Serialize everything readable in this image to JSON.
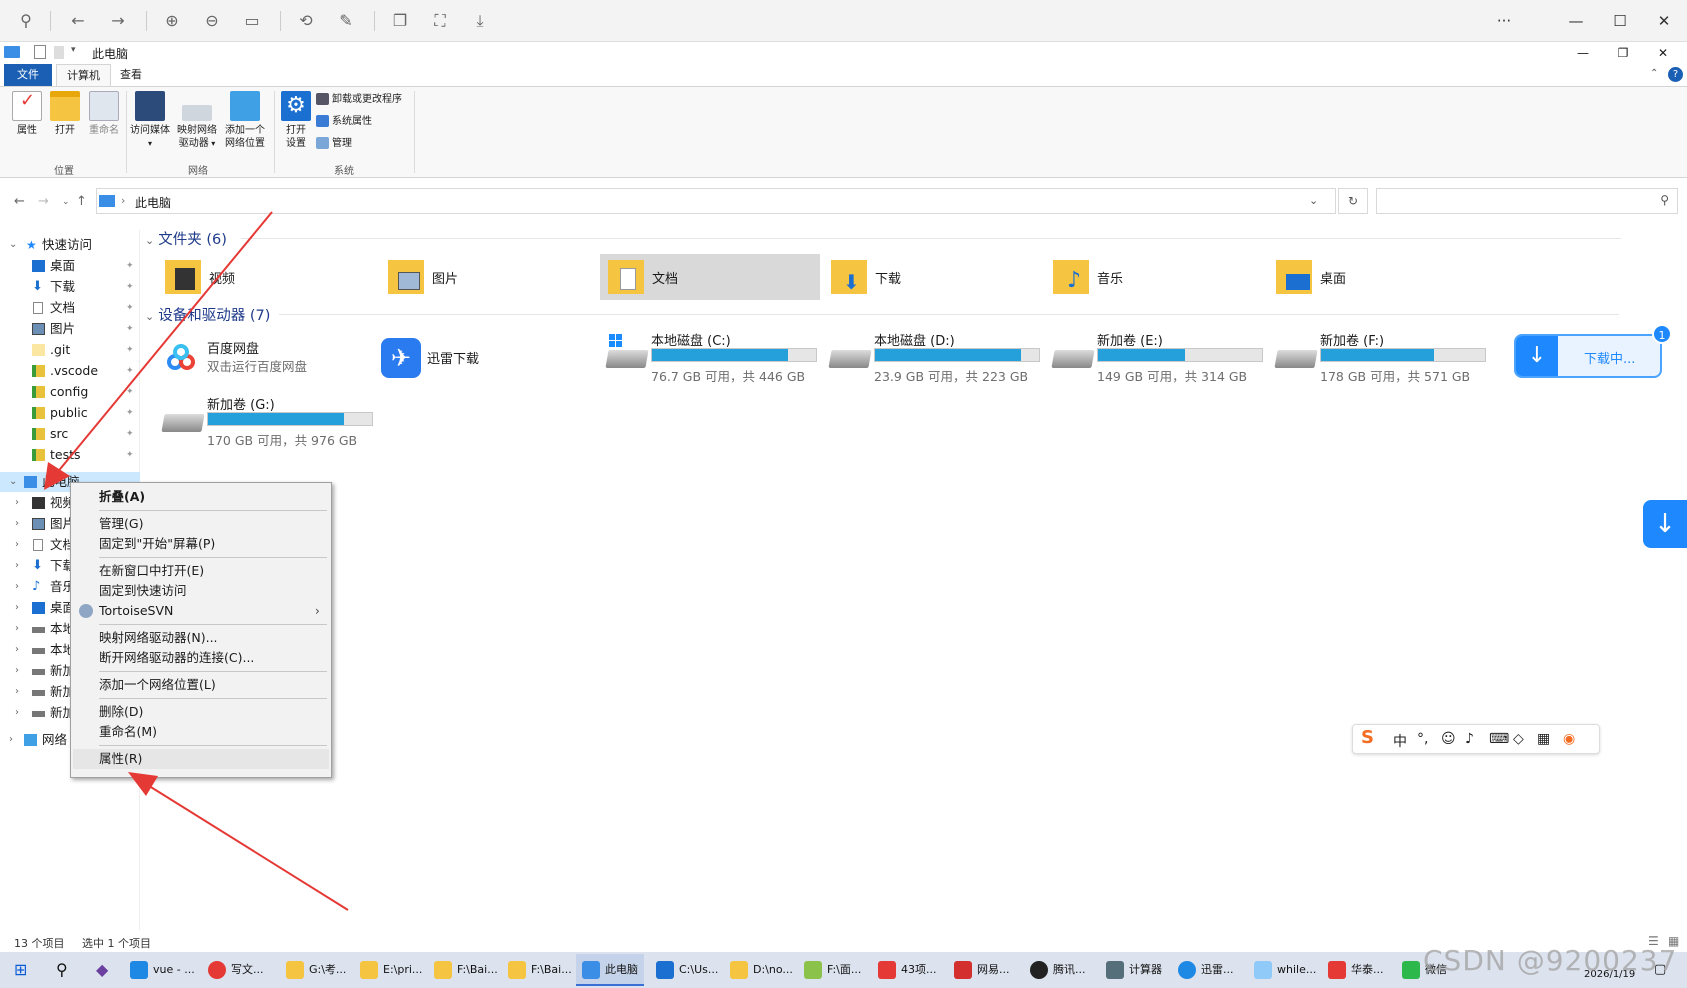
{
  "viewer": {
    "more": "···",
    "minimize": "—",
    "maximize": "☐",
    "close": "✕"
  },
  "window": {
    "title": "此电脑"
  },
  "ribbon": {
    "tabs": [
      "文件",
      "计算机",
      "查看"
    ],
    "location": {
      "group": "位置",
      "properties": "属性",
      "open": "打开",
      "rename": "重命名"
    },
    "network": {
      "group": "网络",
      "access_media": "访问媒体",
      "map_drive_1": "映射网络",
      "map_drive_2": "驱动器",
      "add_location_1": "添加一个",
      "add_location_2": "网络位置"
    },
    "system": {
      "group": "系统",
      "open_settings_1": "打开",
      "open_settings_2": "设置",
      "uninstall": "卸载或更改程序",
      "sys_props": "系统属性",
      "manage": "管理"
    }
  },
  "address": {
    "path": "此电脑",
    "search_placeholder": ""
  },
  "tree": {
    "quick_access": "快速访问",
    "quick_items": [
      "桌面",
      "下载",
      "文档",
      "图片",
      ".git",
      ".vscode",
      "config",
      "public",
      "src",
      "tests"
    ],
    "this_pc": "此电脑",
    "pc_items": [
      "视频",
      "图片",
      "文档",
      "下载",
      "音乐",
      "桌面",
      "本地磁盘 (C:)",
      "本地磁盘 (D:)",
      "新加卷 (E:)",
      "新加卷 (F:)",
      "新加卷 (G:)"
    ],
    "network": "网络"
  },
  "folders": {
    "heading": "文件夹 (6)",
    "items": [
      "视频",
      "图片",
      "文档",
      "下载",
      "音乐",
      "桌面"
    ]
  },
  "drives": {
    "heading": "设备和驱动器 (7)",
    "baidu": {
      "name": "百度网盘",
      "sub": "双击运行百度网盘"
    },
    "xunlei": {
      "name": "迅雷下载"
    },
    "items": [
      {
        "name": "本地磁盘 (C:)",
        "space": "76.7 GB 可用，共 446 GB",
        "used": 0.83
      },
      {
        "name": "本地磁盘 (D:)",
        "space": "23.9 GB 可用，共 223 GB",
        "used": 0.89
      },
      {
        "name": "新加卷 (E:)",
        "space": "149 GB 可用，共 314 GB",
        "used": 0.53
      },
      {
        "name": "新加卷 (F:)",
        "space": "178 GB 可用，共 571 GB",
        "used": 0.69
      },
      {
        "name": "新加卷 (G:)",
        "space": "170 GB 可用，共 976 GB",
        "used": 0.83
      }
    ]
  },
  "context_menu": {
    "collapse": "折叠(A)",
    "manage": "管理(G)",
    "pin_start": "固定到\"开始\"屏幕(P)",
    "open_new": "在新窗口中打开(E)",
    "pin_quick": "固定到快速访问",
    "svn": "TortoiseSVN",
    "map_drive": "映射网络驱动器(N)...",
    "disconnect": "断开网络驱动器的连接(C)...",
    "add_location": "添加一个网络位置(L)",
    "delete": "删除(D)",
    "rename": "重命名(M)",
    "properties": "属性(R)"
  },
  "status": {
    "count": "13 个项目",
    "selected": "选中 1 个项目"
  },
  "download_widget": {
    "label": "下载中...",
    "badge": "1"
  },
  "ime": {
    "lang": "中"
  },
  "taskbar": {
    "items": [
      "vue - ...",
      "写文...",
      "G:\\考...",
      "E:\\pri...",
      "F:\\Bai...",
      "F:\\Bai...",
      "此电脑",
      "C:\\Us...",
      "D:\\no...",
      "F:\\面...",
      "43项...",
      "网易...",
      "腾讯...",
      "计算器",
      "迅雷...",
      "while...",
      "华泰...",
      "微信"
    ],
    "date": "2026/1/19"
  },
  "watermark": "CSDN @9200237",
  "colors": {
    "accent": "#1a5fb4",
    "drive_bar": "#26a0da",
    "arrow": "#e53935",
    "selection": "#cce8ff"
  }
}
